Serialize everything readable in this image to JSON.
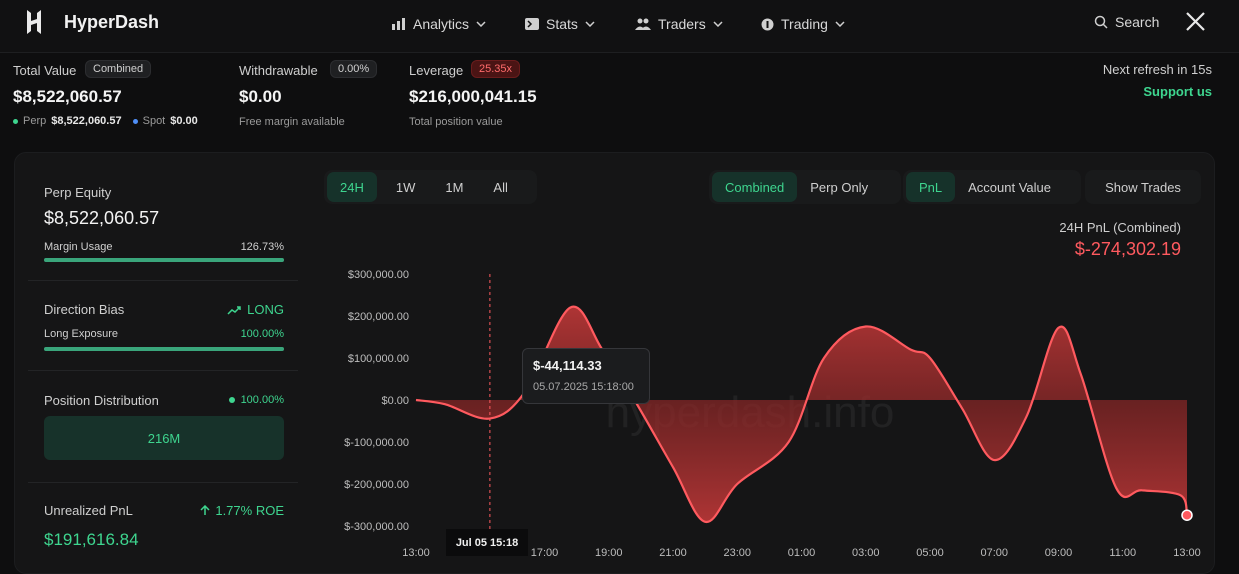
{
  "brand": {
    "name": "HyperDash"
  },
  "nav": {
    "items": [
      {
        "label": "Analytics",
        "icon": "bar-chart-icon"
      },
      {
        "label": "Stats",
        "icon": "terminal-icon"
      },
      {
        "label": "Traders",
        "icon": "users-icon"
      },
      {
        "label": "Trading",
        "icon": "coin-icon"
      }
    ],
    "search_label": "Search",
    "social_icon": "x-logo-icon"
  },
  "summary": {
    "total_value_label": "Total Value",
    "total_value_badge": "Combined",
    "total_value": "$8,522,060.57",
    "perp_label": "Perp",
    "perp_value": "$8,522,060.57",
    "spot_label": "Spot",
    "spot_value": "$0.00",
    "withdrawable_label": "Withdrawable",
    "withdrawable_badge": "0.00%",
    "withdrawable_value": "$0.00",
    "withdrawable_sub": "Free margin available",
    "leverage_label": "Leverage",
    "leverage_badge": "25.35x",
    "leverage_value": "$216,000,041.15",
    "leverage_sub": "Total position value",
    "refresh_text": "Next refresh in 15s",
    "support_link": "Support us"
  },
  "side": {
    "perp_equity_label": "Perp Equity",
    "perp_equity_value": "$8,522,060.57",
    "margin_usage_label": "Margin Usage",
    "margin_usage_value": "126.73%",
    "margin_usage_fraction": 1.0,
    "direction_bias_label": "Direction Bias",
    "direction_bias_value": "LONG",
    "long_exposure_label": "Long Exposure",
    "long_exposure_value": "100.00%",
    "long_exposure_fraction": 1.0,
    "position_dist_label": "Position Distribution",
    "position_dist_value": "100.00%",
    "position_dist_box": "216M",
    "unrealized_label": "Unrealized PnL",
    "unrealized_roe": "1.77% ROE",
    "unrealized_value": "$191,616.84"
  },
  "controls": {
    "ranges": [
      "24H",
      "1W",
      "1M",
      "All"
    ],
    "active_range": "24H",
    "modes": [
      "Combined",
      "Perp Only"
    ],
    "active_mode": "Combined",
    "metrics": [
      "PnL",
      "Account Value"
    ],
    "active_metric": "PnL",
    "show_trades": "Show Trades"
  },
  "chart_header": {
    "label": "24H PnL (Combined)",
    "value": "$-274,302.19"
  },
  "tooltip": {
    "value": "$-44,114.33",
    "date": "05.07.2025 15:18:00",
    "x_tag": "Jul 05 15:18"
  },
  "watermark": "hyperdash.info",
  "colors": {
    "accent": "#3ed58f",
    "negative": "#ff5a5f",
    "badge_red": "#ff6b6b"
  },
  "chart_data": {
    "type": "area",
    "ylim": [
      -300000,
      300000
    ],
    "y_ticks": [
      "$300,000.00",
      "$200,000.00",
      "$100,000.00",
      "$0.00",
      "$-100,000.00",
      "$-200,000.00",
      "$-300,000.00"
    ],
    "y_tick_values": [
      300000,
      200000,
      100000,
      0,
      -100000,
      -200000,
      -300000
    ],
    "x_ticks": [
      "13:00",
      "15:00",
      "17:00",
      "19:00",
      "21:00",
      "23:00",
      "01:00",
      "03:00",
      "05:00",
      "07:00",
      "09:00",
      "11:00",
      "13:00"
    ],
    "x_hours": [
      0,
      2,
      4,
      6,
      8,
      10,
      12,
      14,
      16,
      18,
      20,
      22,
      24
    ],
    "series": [
      {
        "x": [
          0,
          0.9,
          2.3,
          3.4,
          4.8,
          5.8,
          6.8,
          8.0,
          9.0,
          10.0,
          11.6,
          12.7,
          14.0,
          15.4,
          16.0,
          17.0,
          18.0,
          19.0,
          20.0,
          20.7,
          21.8,
          22.6,
          23.8,
          24.0
        ],
        "y": [
          0,
          -10000,
          -44114,
          20000,
          220000,
          120000,
          0,
          -160000,
          -290000,
          -200000,
          -100000,
          100000,
          175000,
          120000,
          100000,
          -20000,
          -143000,
          -40000,
          172000,
          60000,
          -210000,
          -215000,
          -227000,
          -274302
        ]
      }
    ]
  }
}
